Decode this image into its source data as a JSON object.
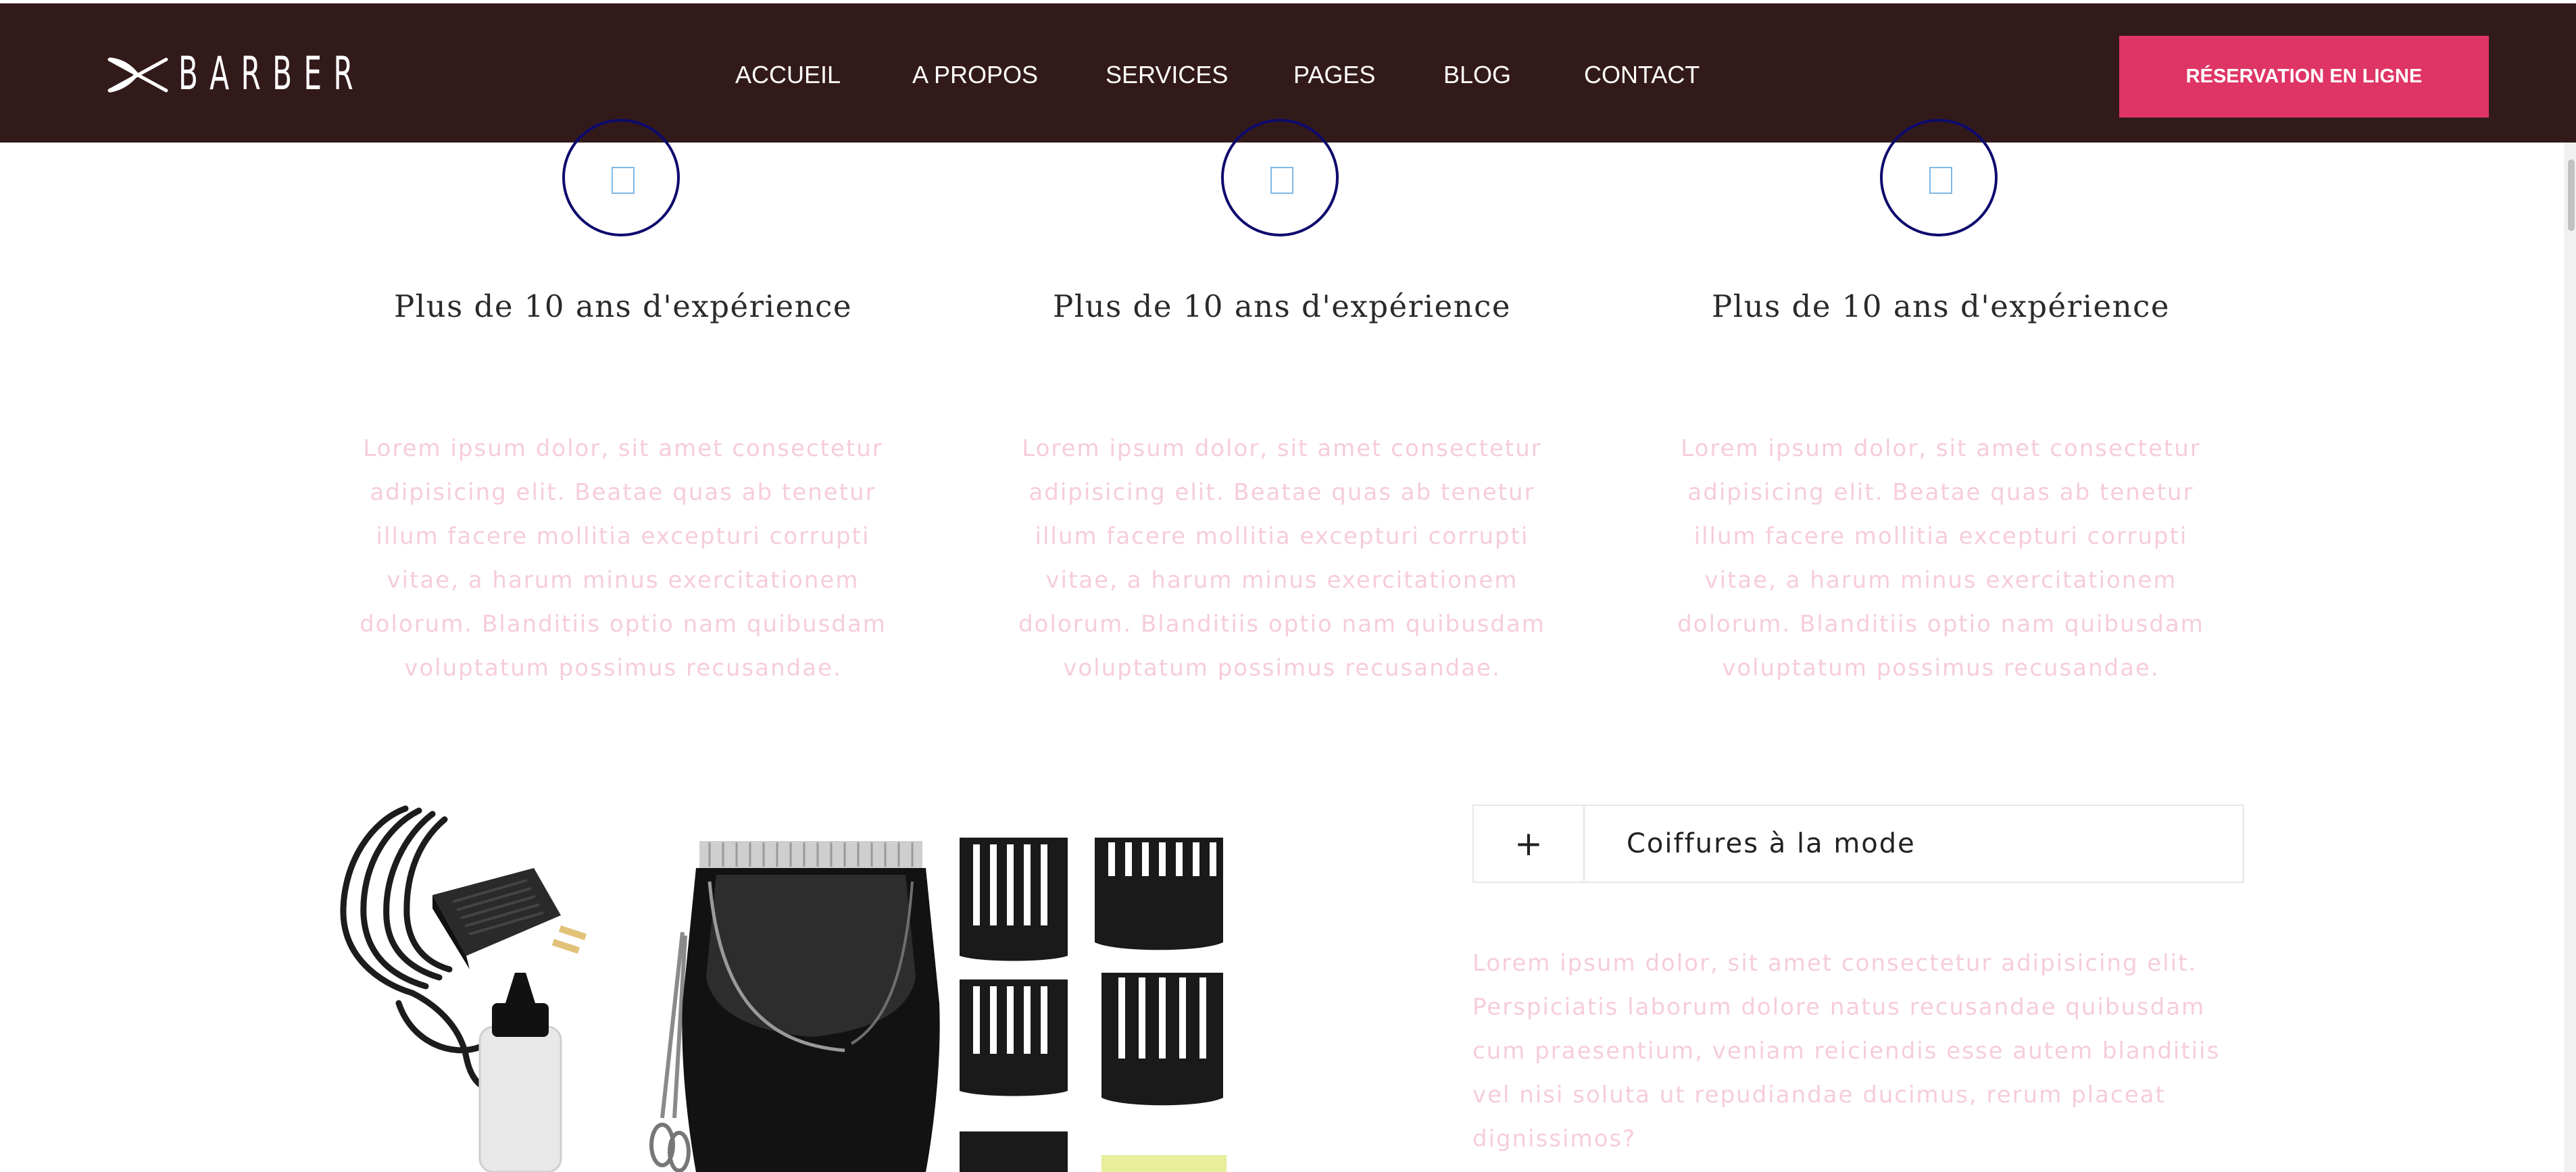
{
  "brand": {
    "name": "BARBER"
  },
  "nav": {
    "items": [
      "ACCUEIL",
      "A PROPOS",
      "SERVICES",
      "PAGES",
      "BLOG",
      "CONTACT"
    ],
    "cta": "RÉSERVATION EN LIGNE"
  },
  "colors": {
    "nav_bg": "#331a1a",
    "cta_bg": "#df3566",
    "circle_border": "#0d0a6e",
    "muted_text": "#f6cdd8"
  },
  "features": [
    {
      "icon": "missing-glyph-icon",
      "title": "Plus de 10 ans d'expérience",
      "text": "Lorem ipsum dolor, sit amet consectetur adipisicing elit. Beatae quas ab tenetur illum facere mollitia excepturi corrupti vitae, a harum minus exercitationem dolorum. Blanditiis optio nam quibusdam voluptatum possimus recusandae."
    },
    {
      "icon": "missing-glyph-icon",
      "title": "Plus de 10 ans d'expérience",
      "text": "Lorem ipsum dolor, sit amet consectetur adipisicing elit. Beatae quas ab tenetur illum facere mollitia excepturi corrupti vitae, a harum minus exercitationem dolorum. Blanditiis optio nam quibusdam voluptatum possimus recusandae."
    },
    {
      "icon": "missing-glyph-icon",
      "title": "Plus de 10 ans d'expérience",
      "text": "Lorem ipsum dolor, sit amet consectetur adipisicing elit. Beatae quas ab tenetur illum facere mollitia excepturi corrupti vitae, a harum minus exercitationem dolorum. Blanditiis optio nam quibusdam voluptatum possimus recusandae."
    }
  ],
  "accordion": {
    "toggle": "+",
    "title": "Coiffures à la mode",
    "body": "Lorem ipsum dolor, sit amet consectetur adipisicing elit. Perspiciatis laborum dolore natus recusandae quibusdam cum praesentium, veniam reiciendis esse autem blanditiis vel nisi soluta ut repudiandae ducimus, rerum placeat dignissimos?"
  },
  "image": {
    "subject": "hair-clipper-kit-image"
  }
}
